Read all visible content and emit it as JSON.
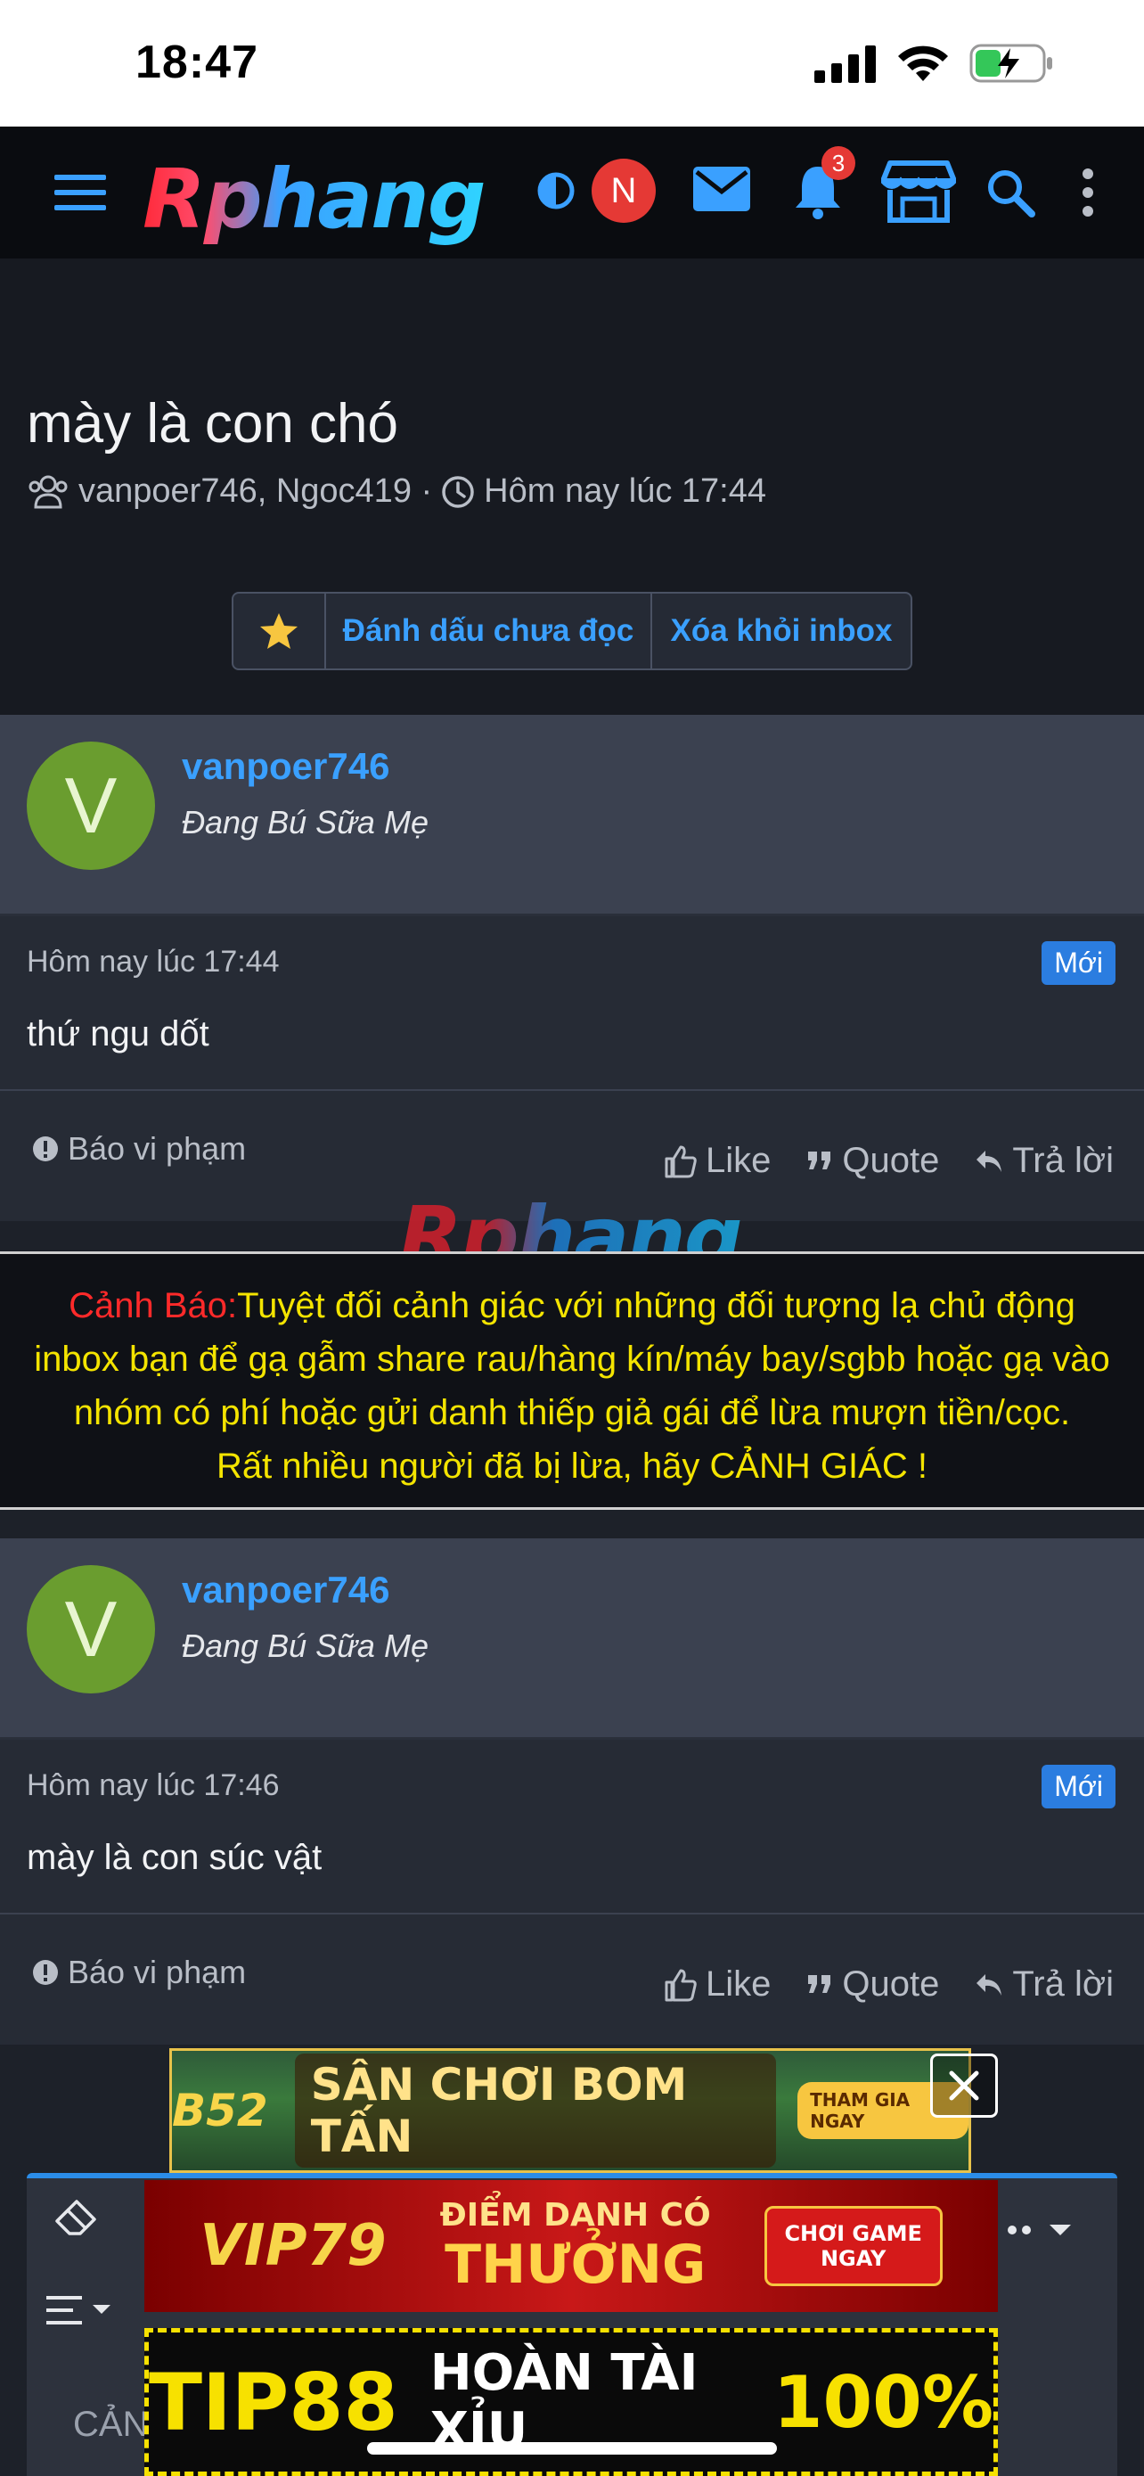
{
  "status_bar": {
    "time": "18:47"
  },
  "nav": {
    "logo": "Rphang",
    "avatar_initial": "N",
    "notification_count": "3"
  },
  "thread": {
    "title": "mày là con chó",
    "participants": "vanpoer746, Ngoc419 ·",
    "time": "Hôm nay lúc 17:44",
    "mark_unread": "Đánh dấu chưa đọc",
    "remove_inbox": "Xóa khỏi inbox"
  },
  "messages": [
    {
      "avatar_initial": "V",
      "username": "vanpoer746",
      "rank": "Đang Bú Sữa Mẹ",
      "time": "Hôm nay lúc 17:44",
      "badge": "Mới",
      "text": "thứ ngu dốt",
      "report": "Báo vi phạm",
      "like": "Like",
      "quote": "Quote",
      "reply": "Trả lời"
    },
    {
      "avatar_initial": "V",
      "username": "vanpoer746",
      "rank": "Đang Bú Sữa Mẹ",
      "time": "Hôm nay lúc 17:46",
      "badge": "Mới",
      "text": "mày là con súc vật",
      "report": "Báo vi phạm",
      "like": "Like",
      "quote": "Quote",
      "reply": "Trả lời"
    }
  ],
  "warning": {
    "label": "Cảnh Báo:",
    "line1": "Tuyệt đối cảnh giác với những đối tượng lạ chủ động",
    "line2": "inbox bạn để gạ gẫm share rau/hàng kín/máy bay/sgbb hoặc gạ vào",
    "line3": "nhóm có phí hoặc gửi danh thiếp giả gái để lừa mượn tiền/cọc.",
    "line4": "Rất nhiều người đã bị lừa, hãy CẢNH GIÁC !"
  },
  "watermark": "Rphang",
  "editor": {
    "placeholder_text": "CẢN"
  },
  "ads": {
    "ad1_brand": "B52",
    "ad1_text": "SÂN CHƠI BOM TẤN",
    "ad1_cta": "THAM GIA NGAY",
    "ad2_brand": "VIP79",
    "ad2_text1": "ĐIỂM DANH CÓ",
    "ad2_text2": "THƯỞNG",
    "ad2_cta": "CHƠI GAME NGAY",
    "ad3_brand": "TIP88",
    "ad3_text": "HOÀN TÀI XỈU",
    "ad3_pct": "100%"
  }
}
